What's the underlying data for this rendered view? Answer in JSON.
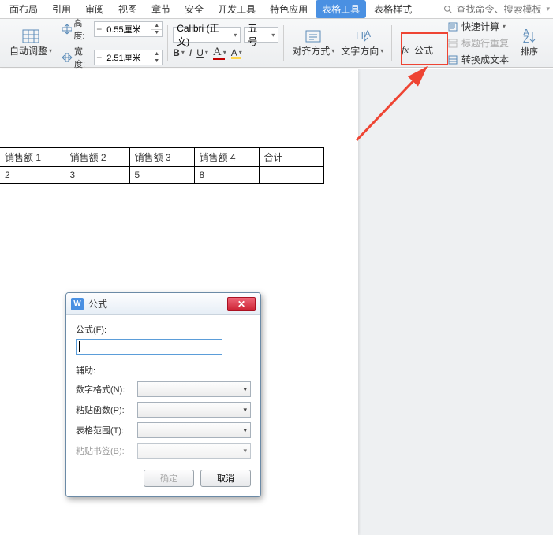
{
  "menu": {
    "items": [
      "面布局",
      "引用",
      "审阅",
      "视图",
      "章节",
      "安全",
      "开发工具",
      "特色应用",
      "表格工具",
      "表格样式"
    ],
    "active_index": 8,
    "search_placeholder": "查找命令、搜索模板"
  },
  "ribbon": {
    "auto_adjust": "自动调整",
    "height_label": "高度:",
    "height_value": "0.55厘米",
    "width_label": "宽度:",
    "width_value": "2.51厘米",
    "font_name": "Calibri (正文)",
    "font_size": "五号",
    "align": "对齐方式",
    "text_dir": "文字方向",
    "formula": "公式",
    "quick_calc": "快速计算",
    "title_repeat": "标题行重复",
    "to_text": "转换成文本",
    "sort": "排序",
    "formula_fx": "fx"
  },
  "table": {
    "headers": [
      "销售额 1",
      "销售额 2",
      "销售额 3",
      "销售额 4",
      "合计"
    ],
    "row1": [
      "2",
      "3",
      "5",
      "8",
      ""
    ]
  },
  "dialog": {
    "title": "公式",
    "formula_label": "公式(F):",
    "formula_value": "",
    "aux_label": "辅助:",
    "num_format": "数字格式(N):",
    "paste_func": "粘贴函数(P):",
    "table_range": "表格范围(T):",
    "paste_bookmark": "粘贴书签(B):",
    "ok": "确定",
    "cancel": "取消"
  },
  "icons": {
    "table": "table-grid",
    "height": "height-arrows",
    "width": "width-arrows",
    "align": "align-cells",
    "textdir": "text-direction",
    "calc": "sigma",
    "repeat": "rows-repeat",
    "totext": "rows-text",
    "sort": "sort-az",
    "search": "magnifier",
    "close": "close-x"
  },
  "colors": {
    "highlight_red": "#e43",
    "font_color": "#c00000",
    "highlight_yellow": "#ffd54a"
  }
}
